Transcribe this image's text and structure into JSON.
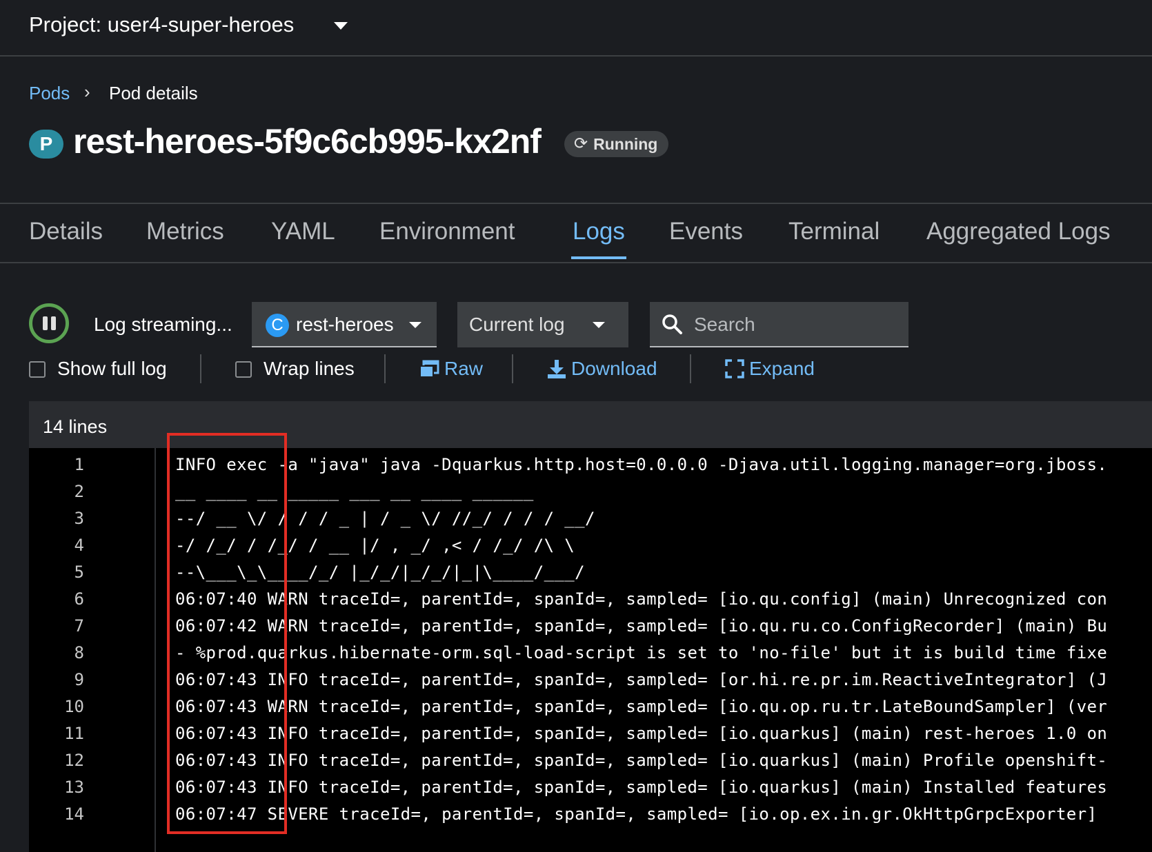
{
  "project": {
    "label": "Project: user4-super-heroes"
  },
  "breadcrumb": {
    "parent": "Pods",
    "separator": "›",
    "current": "Pod details"
  },
  "pod": {
    "badge": "P",
    "name": "rest-heroes-5f9c6cb995-kx2nf",
    "status": "Running"
  },
  "tabs": [
    {
      "label": "Details"
    },
    {
      "label": "Metrics"
    },
    {
      "label": "YAML"
    },
    {
      "label": "Environment"
    },
    {
      "label": "Logs",
      "active": true
    },
    {
      "label": "Events"
    },
    {
      "label": "Terminal"
    },
    {
      "label": "Aggregated Logs"
    }
  ],
  "toolbar": {
    "streaming_label": "Log streaming...",
    "container_badge": "C",
    "container_name": "rest-heroes",
    "log_select": "Current log",
    "search_placeholder": "Search"
  },
  "options": {
    "show_full_log": "Show full log",
    "wrap_lines": "Wrap lines",
    "raw": "Raw",
    "download": "Download",
    "expand": "Expand"
  },
  "log": {
    "lines_count": "14 lines",
    "lines": [
      {
        "n": "1",
        "text": "INFO exec -a \"java\" java -Dquarkus.http.host=0.0.0.0 -Djava.util.logging.manager=org.jboss."
      },
      {
        "n": "2",
        "text": "__  ____  __  _____   ___  __ ____  ______"
      },
      {
        "n": "3",
        "text": "--/ __ \\/ / / / _ | / _ \\/ //_/ / / / __/"
      },
      {
        "n": "4",
        "text": "-/ /_/ / /_/ / __ |/ , _/ ,< / /_/ /\\ \\"
      },
      {
        "n": "5",
        "text": "--\\___\\_\\____/_/ |_/_/|_/_/|_|\\____/___/"
      },
      {
        "n": "6",
        "text": "06:07:40 WARN traceId=, parentId=, spanId=, sampled= [io.qu.config] (main) Unrecognized con"
      },
      {
        "n": "7",
        "text": "06:07:42 WARN traceId=, parentId=, spanId=, sampled= [io.qu.ru.co.ConfigRecorder] (main) Bu"
      },
      {
        "n": "8",
        "text": "- %prod.quarkus.hibernate-orm.sql-load-script is set to 'no-file' but it is build time fixe"
      },
      {
        "n": "9",
        "text": "06:07:43 INFO traceId=, parentId=, spanId=, sampled= [or.hi.re.pr.im.ReactiveIntegrator] (J"
      },
      {
        "n": "10",
        "text": "06:07:43 WARN traceId=, parentId=, spanId=, sampled= [io.qu.op.ru.tr.LateBoundSampler] (ver"
      },
      {
        "n": "11",
        "text": "06:07:43 INFO traceId=, parentId=, spanId=, sampled= [io.quarkus] (main) rest-heroes 1.0 on"
      },
      {
        "n": "12",
        "text": "06:07:43 INFO traceId=, parentId=, spanId=, sampled= [io.quarkus] (main) Profile openshift-"
      },
      {
        "n": "13",
        "text": "06:07:43 INFO traceId=, parentId=, spanId=, sampled= [io.quarkus] (main) Installed features"
      },
      {
        "n": "14",
        "text": "06:07:47 SEVERE traceId=, parentId=, spanId=, sampled= [io.op.ex.in.gr.OkHttpGrpcExporter]"
      }
    ]
  },
  "colors": {
    "accent": "#73bcf7",
    "running": "#5ba352",
    "highlight": "#e22d24"
  },
  "icons": [
    "chevron-down-icon",
    "sync-icon",
    "pause-icon",
    "search-icon",
    "raw-icon",
    "download-icon",
    "expand-icon"
  ]
}
